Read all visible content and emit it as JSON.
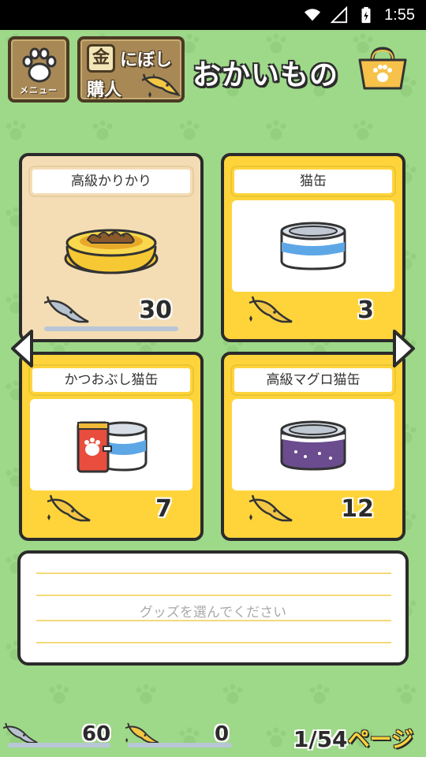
{
  "status_bar": {
    "time": "1:55"
  },
  "header": {
    "menu_label": "メニュー",
    "gold_kanji": "金",
    "gold_line1": "にぼし",
    "gold_line2": "購人",
    "title": "おかいもの"
  },
  "items": [
    {
      "name": "高級かりかり",
      "price": "30",
      "currency": "silver-fish",
      "selected": true
    },
    {
      "name": "猫缶",
      "price": "3",
      "currency": "gold-fish",
      "selected": false
    },
    {
      "name": "かつおぶし猫缶",
      "price": "7",
      "currency": "gold-fish",
      "selected": false
    },
    {
      "name": "高級マグロ猫缶",
      "price": "12",
      "currency": "gold-fish",
      "selected": false
    }
  ],
  "description": {
    "placeholder": "グッズを選んでください"
  },
  "footer": {
    "silver_count": "60",
    "gold_count": "0",
    "page_current": "1",
    "page_sep": "/",
    "page_total": "54",
    "page_suffix": "ページ"
  },
  "colors": {
    "background": "#9ed889",
    "card_yellow": "#ffd43b",
    "card_selected": "#f4ddb5",
    "outline": "#2b2b2b"
  }
}
